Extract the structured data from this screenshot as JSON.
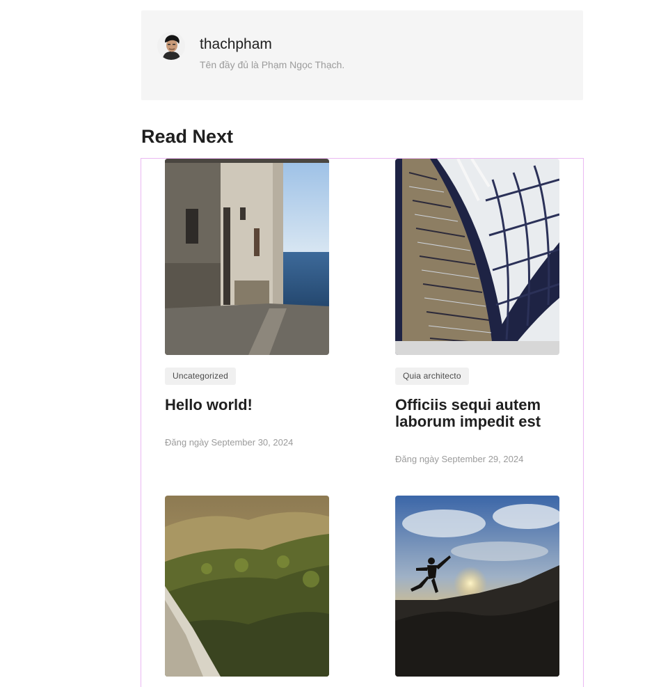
{
  "author": {
    "name": "thachpham",
    "description": "Tên đầy đủ là Phạm Ngọc Thạch.",
    "avatar_icon": "avatar-photo"
  },
  "read_next": {
    "title": "Read Next",
    "posts": [
      {
        "category": "Uncategorized",
        "title": "Hello world!",
        "date": "Đăng ngày September 30, 2024",
        "image": "street-by-the-sea"
      },
      {
        "category": "Quia architecto",
        "title": "Officiis sequi autem laborum impedit est",
        "date": "Đăng ngày September 29, 2024",
        "image": "curved-library-shelves"
      },
      {
        "image": "forested-mountains"
      },
      {
        "image": "person-jumping-at-sunset"
      }
    ]
  },
  "colors": {
    "author_box_bg": "#f5f5f5",
    "grid_outline": "#eab8f2",
    "badge_bg": "#f0f0f0",
    "muted_text": "#9b9b9b"
  }
}
